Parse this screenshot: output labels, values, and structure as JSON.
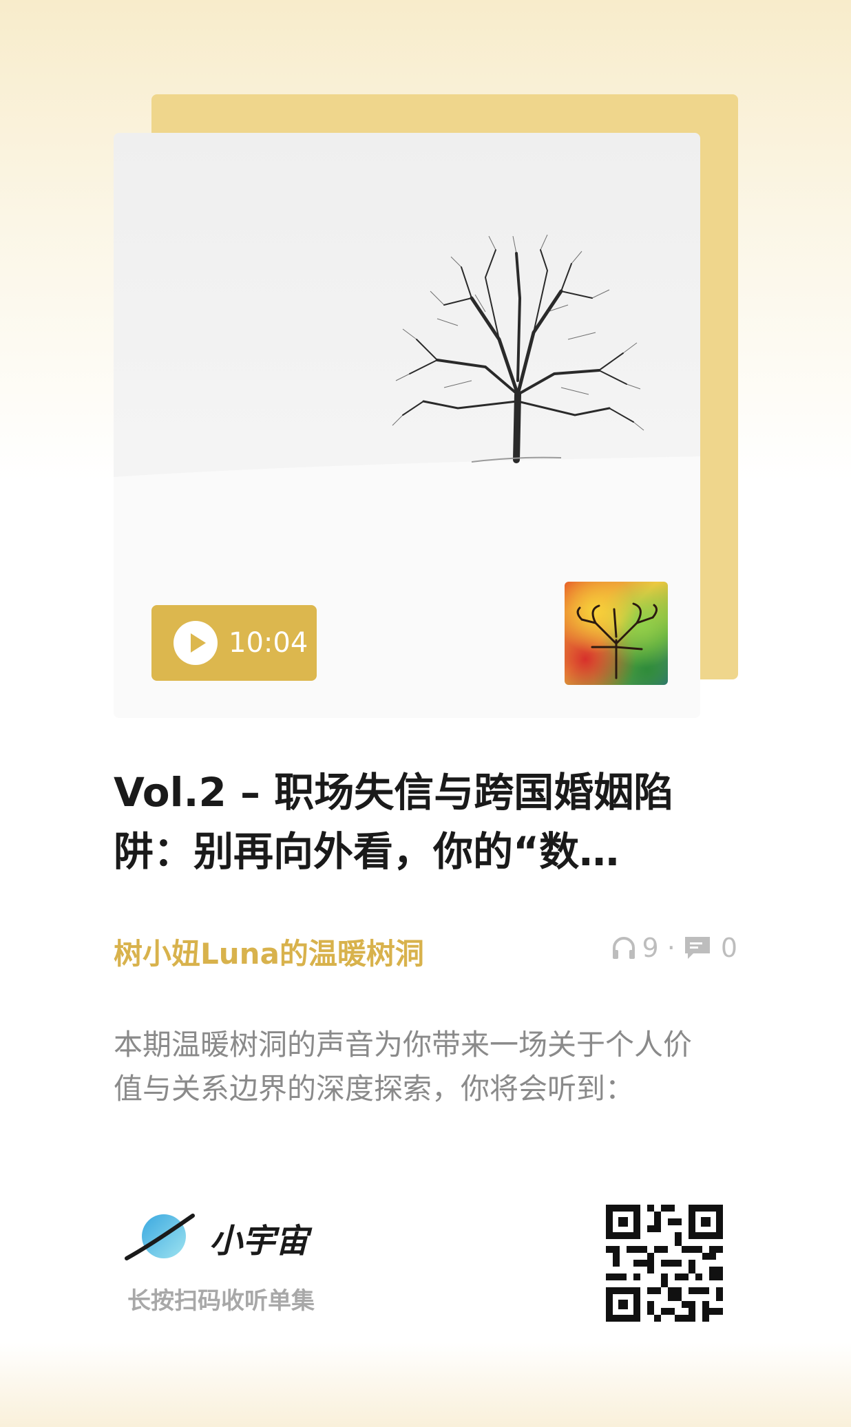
{
  "player": {
    "duration": "10:04"
  },
  "episode": {
    "title": "Vol.2 – 职场失信与跨国婚姻陷阱：别再向外看，你的“数…",
    "author": "树小妞Luna的温暖树洞",
    "listens": "9",
    "comments": "0",
    "description": "本期温暖树洞的声音为你带来一场关于个人价值与关系边界的深度探索，你将会听到："
  },
  "footer": {
    "brand": "小宇宙",
    "scan_hint": "长按扫码收听单集"
  },
  "colors": {
    "accent": "#dcb74e",
    "author": "#d8b24c",
    "cover_back": "#efd68c"
  },
  "icons": {
    "play": "play-icon",
    "headphones": "headphones-icon",
    "comment": "comment-icon",
    "logo": "planet-logo-icon"
  }
}
